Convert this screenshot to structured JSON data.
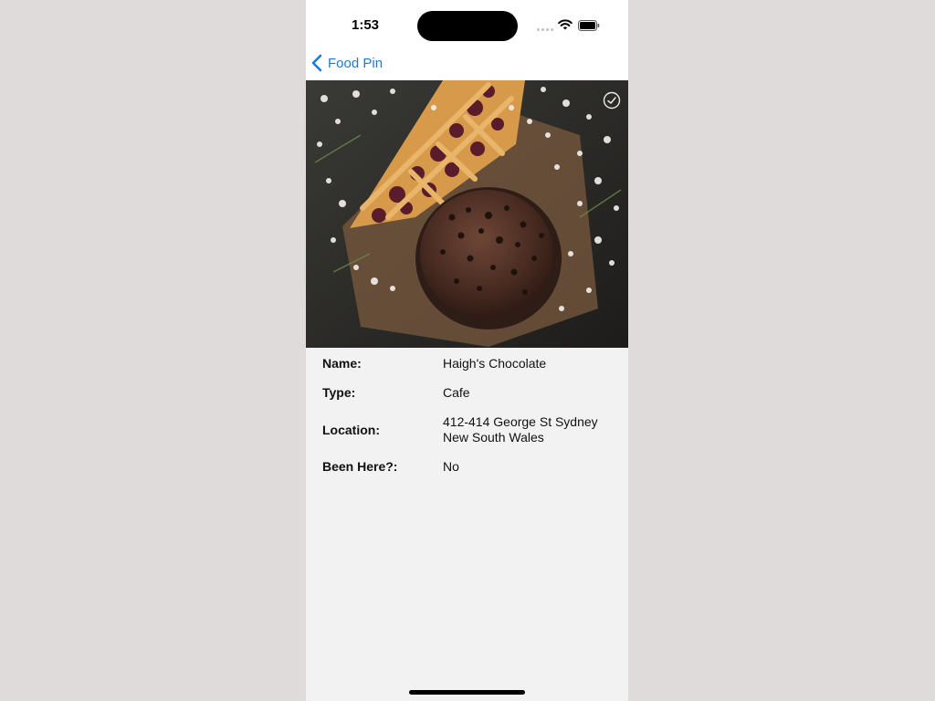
{
  "status_bar": {
    "time": "1:53",
    "icons": [
      "cellular-signal-icon",
      "wifi-icon",
      "battery-icon"
    ]
  },
  "nav": {
    "back_label": "Food Pin",
    "accent": "#1a7ad9"
  },
  "hero": {
    "image": "chocolate-muffin-and-lattice-pie-photo",
    "badge_icon": "checkmark-circle-icon"
  },
  "details": [
    {
      "label": "Name:",
      "value": "Haigh's Chocolate"
    },
    {
      "label": "Type:",
      "value": "Cafe"
    },
    {
      "label": "Location:",
      "value": "412-414 George St Sydney",
      "value_line2": "New South Wales"
    },
    {
      "label": "Been Here?:",
      "value": "No"
    }
  ]
}
